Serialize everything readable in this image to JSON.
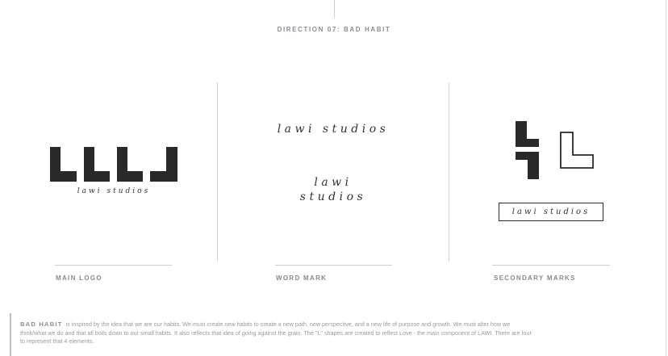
{
  "header": {
    "title": "DIRECTION 07: BAD HABIT"
  },
  "main_logo": {
    "wordmark": "lawi studios",
    "caption": "MAIN LOGO"
  },
  "word_mark": {
    "line1": "lawi studios",
    "stacked_top": "lawi",
    "stacked_bottom": "studios",
    "caption": "WORD MARK"
  },
  "secondary_marks": {
    "boxed_wordmark": "lawi studios",
    "caption": "SECONDARY MARKS"
  },
  "description": {
    "lead": "BAD HABIT",
    "body": "is inspired by the idea that we are our habits. We must create new habits to create a new path, new perspective, and a new life of purpose and growth. We must alter how we think/what we do and that all boils down to our small habits. It also reflects that idea of going against the grain. The \"L\" shapes are created to reflect Love - the main component of LAWI. There are four to represent that 4 elements."
  },
  "colors": {
    "ink": "#2a2828",
    "caption_gray": "#8a8a8a",
    "title_purple_gray": "#8e8a9a"
  }
}
